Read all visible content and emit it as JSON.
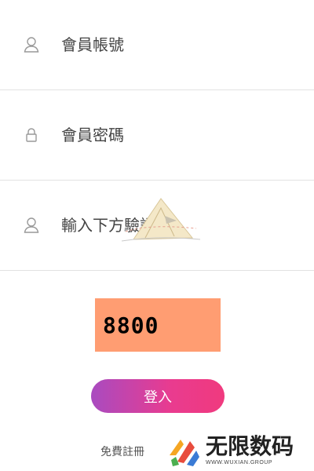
{
  "form": {
    "account_placeholder": "會員帳號",
    "password_placeholder": "會員密碼",
    "captcha_placeholder": "輸入下方驗證碼"
  },
  "captcha": {
    "code": "8800",
    "background_color": "#ff9d72"
  },
  "actions": {
    "login_label": "登入",
    "register_label": "免費註冊"
  },
  "icons": {
    "account": "user-icon",
    "password": "lock-icon",
    "captcha": "user-icon"
  },
  "watermark": {
    "title": "无限数码",
    "subtitle": "WWW.WUXIAN.GROUP"
  },
  "colors": {
    "button_gradient_start": "#a94bc0",
    "button_gradient_end": "#f03a7e",
    "divider": "#e2e2e2"
  }
}
